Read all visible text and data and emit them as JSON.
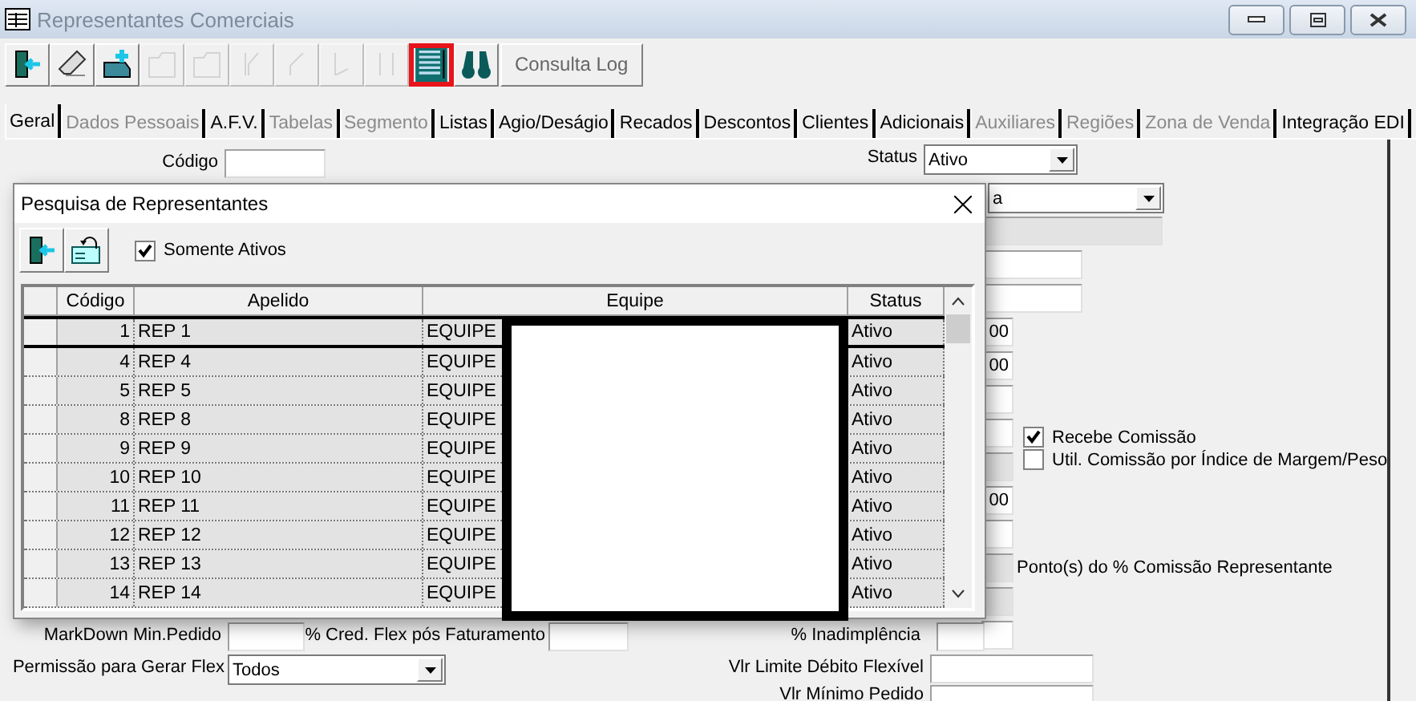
{
  "window": {
    "title": "Representantes Comerciais"
  },
  "toolbar": {
    "buttons": [
      {
        "kind": "exit",
        "disabled": false,
        "highlighted": false
      },
      {
        "kind": "eraser",
        "disabled": false,
        "highlighted": false
      },
      {
        "kind": "add",
        "disabled": false,
        "highlighted": false
      },
      {
        "kind": "copy",
        "disabled": true,
        "highlighted": false
      },
      {
        "kind": "move",
        "disabled": true,
        "highlighted": false
      },
      {
        "kind": "first",
        "disabled": true,
        "highlighted": false
      },
      {
        "kind": "prev",
        "disabled": true,
        "highlighted": false
      },
      {
        "kind": "next",
        "disabled": true,
        "highlighted": false
      },
      {
        "kind": "last",
        "disabled": true,
        "highlighted": false
      },
      {
        "kind": "grid",
        "disabled": false,
        "highlighted": true
      },
      {
        "kind": "search",
        "disabled": false,
        "highlighted": false
      }
    ],
    "log_button": "Consulta Log"
  },
  "tabs": [
    {
      "label": "Geral",
      "selected": true,
      "disabled": false
    },
    {
      "label": "Dados Pessoais",
      "selected": false,
      "disabled": true
    },
    {
      "label": "A.F.V.",
      "selected": false,
      "disabled": false
    },
    {
      "label": "Tabelas",
      "selected": false,
      "disabled": true
    },
    {
      "label": "Segmento",
      "selected": false,
      "disabled": true
    },
    {
      "label": "Listas",
      "selected": false,
      "disabled": false
    },
    {
      "label": "Agio/Deságio",
      "selected": false,
      "disabled": false
    },
    {
      "label": "Recados",
      "selected": false,
      "disabled": false
    },
    {
      "label": "Descontos",
      "selected": false,
      "disabled": false
    },
    {
      "label": "Clientes",
      "selected": false,
      "disabled": false
    },
    {
      "label": "Adicionais",
      "selected": false,
      "disabled": false
    },
    {
      "label": "Auxiliares",
      "selected": false,
      "disabled": true
    },
    {
      "label": "Regiões",
      "selected": false,
      "disabled": true
    },
    {
      "label": "Zona de Venda",
      "selected": false,
      "disabled": true
    },
    {
      "label": "Integração EDI",
      "selected": false,
      "disabled": false
    }
  ],
  "form": [
    {
      "kind": "label",
      "text": "Código"
    },
    {
      "kind": "field",
      "disabled": false
    },
    {
      "kind": "label",
      "text": "Status"
    },
    {
      "kind": "combo",
      "value": "Ativo"
    },
    {
      "kind": "combo",
      "value": "a"
    },
    {
      "kind": "field",
      "disabled": true
    },
    {
      "kind": "field",
      "disabled": false
    },
    {
      "kind": "field",
      "disabled": false
    },
    {
      "kind": "field",
      "value": "00",
      "disabled": false
    },
    {
      "kind": "field",
      "value": "00",
      "disabled": false
    },
    {
      "kind": "field",
      "disabled": false
    },
    {
      "kind": "field",
      "disabled": false
    },
    {
      "kind": "field",
      "disabled": true
    },
    {
      "kind": "field",
      "value": "00",
      "disabled": false
    },
    {
      "kind": "field",
      "disabled": false
    },
    {
      "kind": "field",
      "disabled": true
    },
    {
      "kind": "field",
      "disabled": true
    },
    {
      "kind": "field",
      "disabled": false
    },
    {
      "kind": "checkbox",
      "label": "Recebe Comissão",
      "checked": true
    },
    {
      "kind": "checkbox",
      "label": "Util. Comissão por Índice de Margem/Peso",
      "checked": false
    },
    {
      "kind": "label",
      "text": "Ponto(s) do % Comissão Representante"
    },
    {
      "kind": "label",
      "text": "MarkDown Min.Pedido"
    },
    {
      "kind": "field",
      "disabled": false
    },
    {
      "kind": "label",
      "text": "% Cred. Flex pós Faturamento"
    },
    {
      "kind": "field",
      "disabled": false
    },
    {
      "kind": "label",
      "text": "% Inadimplência"
    },
    {
      "kind": "field",
      "disabled": false
    },
    {
      "kind": "label",
      "text": "Permissão para Gerar Flex"
    },
    {
      "kind": "combo",
      "value": "Todos"
    },
    {
      "kind": "label",
      "text": "Vlr Limite Débito Flexível"
    },
    {
      "kind": "field",
      "disabled": false
    },
    {
      "kind": "label",
      "text": "Vlr Mínimo Pedido"
    },
    {
      "kind": "field",
      "disabled": false
    }
  ],
  "dialog": {
    "title": "Pesquisa de Representantes",
    "only_active": {
      "label": "Somente Ativos",
      "checked": true
    },
    "columns": [
      "Código",
      "Apelido",
      "Equipe",
      "Status"
    ],
    "rows": [
      {
        "codigo": "1",
        "apelido": "REP 1",
        "equipe": "EQUIPE",
        "status": "Ativo",
        "selected": true
      },
      {
        "codigo": "4",
        "apelido": "REP 4",
        "equipe": "EQUIPE",
        "status": "Ativo",
        "selected": false
      },
      {
        "codigo": "5",
        "apelido": "REP 5",
        "equipe": "EQUIPE",
        "status": "Ativo",
        "selected": false
      },
      {
        "codigo": "8",
        "apelido": "REP 8",
        "equipe": "EQUIPE",
        "status": "Ativo",
        "selected": false
      },
      {
        "codigo": "9",
        "apelido": "REP 9",
        "equipe": "EQUIPE",
        "status": "Ativo",
        "selected": false
      },
      {
        "codigo": "10",
        "apelido": "REP 10",
        "equipe": "EQUIPE",
        "status": "Ativo",
        "selected": false
      },
      {
        "codigo": "11",
        "apelido": "REP 11",
        "equipe": "EQUIPE",
        "status": "Ativo",
        "selected": false
      },
      {
        "codigo": "12",
        "apelido": "REP 12",
        "equipe": "EQUIPE",
        "status": "Ativo",
        "selected": false
      },
      {
        "codigo": "13",
        "apelido": "REP 13",
        "equipe": "EQUIPE",
        "status": "Ativo",
        "selected": false
      },
      {
        "codigo": "14",
        "apelido": "REP 14",
        "equipe": "EQUIPE",
        "status": "Ativo",
        "selected": false
      }
    ]
  }
}
